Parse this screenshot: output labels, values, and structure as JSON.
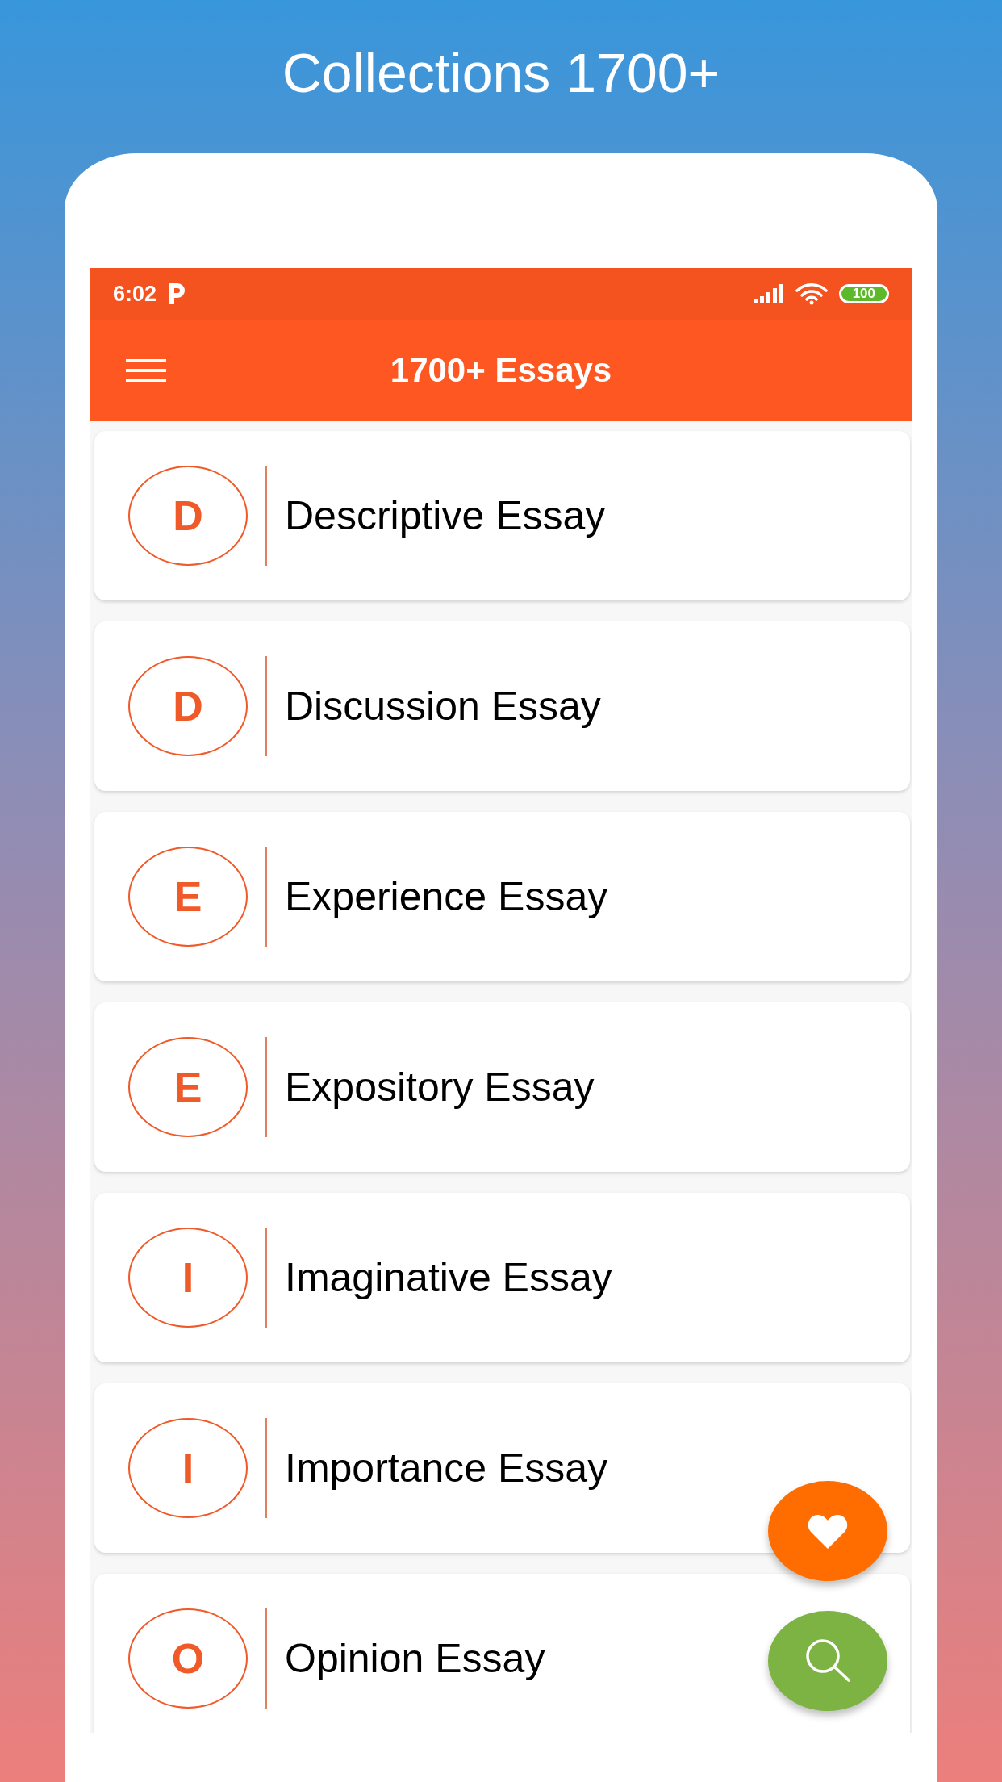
{
  "headline": "Collections 1700+",
  "status_bar": {
    "time": "6:02",
    "battery": "100"
  },
  "app_bar": {
    "title": "1700+ Essays"
  },
  "items": [
    {
      "letter": "D",
      "title": "Descriptive Essay"
    },
    {
      "letter": "D",
      "title": "Discussion Essay"
    },
    {
      "letter": "E",
      "title": "Experience Essay"
    },
    {
      "letter": "E",
      "title": "Expository Essay"
    },
    {
      "letter": "I",
      "title": "Imaginative Essay"
    },
    {
      "letter": "I",
      "title": "Importance Essay"
    },
    {
      "letter": "O",
      "title": "Opinion Essay"
    }
  ]
}
